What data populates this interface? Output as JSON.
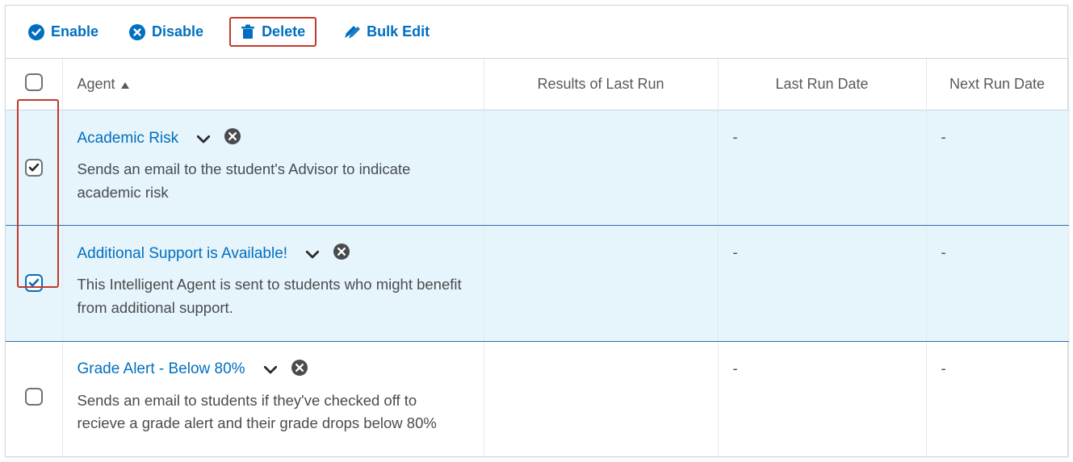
{
  "toolbar": {
    "enable_label": "Enable",
    "disable_label": "Disable",
    "delete_label": "Delete",
    "bulkedit_label": "Bulk Edit"
  },
  "table": {
    "headers": {
      "agent": "Agent",
      "results": "Results of Last Run",
      "last_run": "Last Run Date",
      "next_run": "Next Run Date"
    },
    "rows": [
      {
        "selected": true,
        "agent_name": "Academic Risk",
        "agent_desc": "Sends an email to the student's Advisor to indicate academic risk",
        "results": "",
        "last_run": "-",
        "next_run": "-"
      },
      {
        "selected": true,
        "agent_name": "Additional Support is Available!",
        "agent_desc": "This Intelligent Agent is sent to students who might benefit from additional support.",
        "results": "",
        "last_run": "-",
        "next_run": "-"
      },
      {
        "selected": false,
        "agent_name": "Grade Alert - Below 80%",
        "agent_desc": "Sends an email to students if they've checked off to recieve a grade alert and their grade drops below 80%",
        "results": "",
        "last_run": "-",
        "next_run": "-"
      }
    ]
  }
}
